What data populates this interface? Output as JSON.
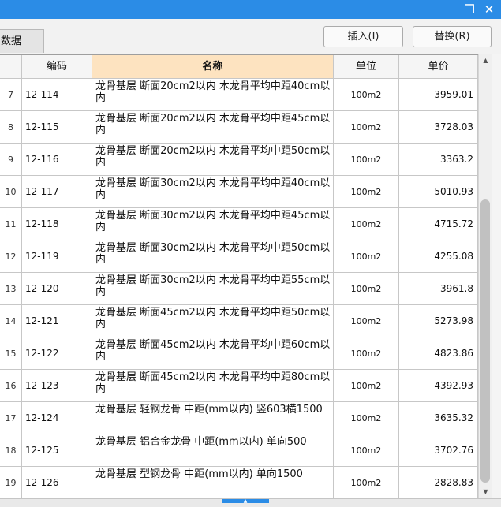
{
  "tab": {
    "label": "数据"
  },
  "buttons": {
    "insert": "插入(I)",
    "replace": "替换(R)"
  },
  "headers": {
    "code": "编码",
    "name": "名称",
    "unit": "单位",
    "price": "单价"
  },
  "rows": [
    {
      "index": "7",
      "code": "12-114",
      "name": "龙骨基层 断面20cm2以内 木龙骨平均中距40cm以内",
      "unit": "100m2",
      "price": "3959.01"
    },
    {
      "index": "8",
      "code": "12-115",
      "name": "龙骨基层 断面20cm2以内 木龙骨平均中距45cm以内",
      "unit": "100m2",
      "price": "3728.03"
    },
    {
      "index": "9",
      "code": "12-116",
      "name": "龙骨基层 断面20cm2以内 木龙骨平均中距50cm以内",
      "unit": "100m2",
      "price": "3363.2"
    },
    {
      "index": "10",
      "code": "12-117",
      "name": "龙骨基层 断面30cm2以内 木龙骨平均中距40cm以内",
      "unit": "100m2",
      "price": "5010.93"
    },
    {
      "index": "11",
      "code": "12-118",
      "name": "龙骨基层 断面30cm2以内 木龙骨平均中距45cm以内",
      "unit": "100m2",
      "price": "4715.72"
    },
    {
      "index": "12",
      "code": "12-119",
      "name": "龙骨基层 断面30cm2以内 木龙骨平均中距50cm以内",
      "unit": "100m2",
      "price": "4255.08"
    },
    {
      "index": "13",
      "code": "12-120",
      "name": "龙骨基层 断面30cm2以内 木龙骨平均中距55cm以内",
      "unit": "100m2",
      "price": "3961.8"
    },
    {
      "index": "14",
      "code": "12-121",
      "name": "龙骨基层 断面45cm2以内 木龙骨平均中距50cm以内",
      "unit": "100m2",
      "price": "5273.98"
    },
    {
      "index": "15",
      "code": "12-122",
      "name": "龙骨基层 断面45cm2以内 木龙骨平均中距60cm以内",
      "unit": "100m2",
      "price": "4823.86"
    },
    {
      "index": "16",
      "code": "12-123",
      "name": "龙骨基层 断面45cm2以内 木龙骨平均中距80cm以内",
      "unit": "100m2",
      "price": "4392.93"
    },
    {
      "index": "17",
      "code": "12-124",
      "name": "龙骨基层 轻钢龙骨 中距(mm以内) 竖603横1500",
      "unit": "100m2",
      "price": "3635.32"
    },
    {
      "index": "18",
      "code": "12-125",
      "name": "龙骨基层 铝合金龙骨 中距(mm以内) 单向500",
      "unit": "100m2",
      "price": "3702.76"
    },
    {
      "index": "19",
      "code": "12-126",
      "name": "龙骨基层 型钢龙骨 中距(mm以内) 单向1500",
      "unit": "100m2",
      "price": "2828.83"
    }
  ],
  "icons": {
    "restore": "restore-icon",
    "close": "close-icon",
    "scroll_up": "scroll-up-icon",
    "scroll_down": "scroll-down-icon",
    "expand": "expand-up-icon"
  },
  "colors": {
    "titlebar": "#2b8ce6",
    "header_highlight": "#fde3c0",
    "grid_line": "#c7c7c7"
  }
}
